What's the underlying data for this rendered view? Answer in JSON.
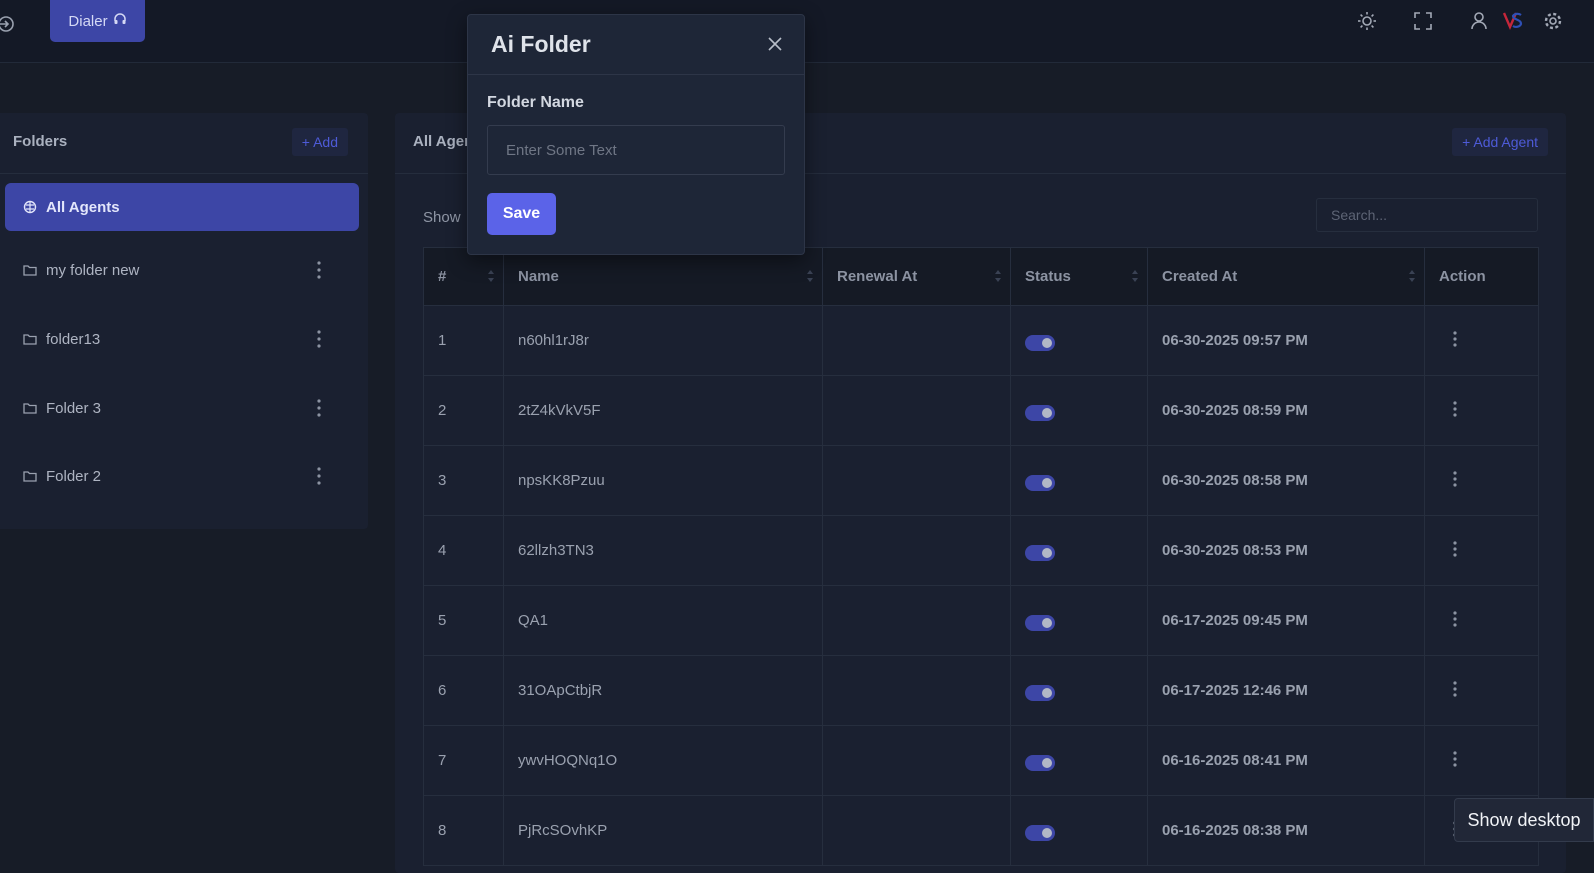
{
  "topbar": {
    "dialer_label": "Dialer"
  },
  "sidebar": {
    "title": "Folders",
    "add_label": "+ Add",
    "items": [
      {
        "label": "All Agents"
      },
      {
        "label": "my folder new"
      },
      {
        "label": "folder13"
      },
      {
        "label": "Folder 3"
      },
      {
        "label": "Folder 2"
      }
    ]
  },
  "main": {
    "title": "All Agents",
    "add_agent_label": "+ Add Agent",
    "show_label": "Show",
    "search_placeholder": "Search...",
    "columns": [
      "#",
      "Name",
      "Renewal At",
      "Status",
      "Created At",
      "Action"
    ],
    "rows": [
      {
        "num": "1",
        "name": "n60hl1rJ8r",
        "renewal": "",
        "status": true,
        "created": "06-30-2025 09:57 PM"
      },
      {
        "num": "2",
        "name": "2tZ4kVkV5F",
        "renewal": "",
        "status": true,
        "created": "06-30-2025 08:59 PM"
      },
      {
        "num": "3",
        "name": "npsKK8Pzuu",
        "renewal": "",
        "status": true,
        "created": "06-30-2025 08:58 PM"
      },
      {
        "num": "4",
        "name": "62llzh3TN3",
        "renewal": "",
        "status": true,
        "created": "06-30-2025 08:53 PM"
      },
      {
        "num": "5",
        "name": "QA1",
        "renewal": "",
        "status": true,
        "created": "06-17-2025 09:45 PM"
      },
      {
        "num": "6",
        "name": "31OApCtbjR",
        "renewal": "",
        "status": true,
        "created": "06-17-2025 12:46 PM"
      },
      {
        "num": "7",
        "name": "ywvHOQNq1O",
        "renewal": "",
        "status": true,
        "created": "06-16-2025 08:41 PM"
      },
      {
        "num": "8",
        "name": "PjRcSOvhKP",
        "renewal": "",
        "status": true,
        "created": "06-16-2025 08:38 PM"
      }
    ]
  },
  "modal": {
    "title": "Ai Folder",
    "field_label": "Folder Name",
    "input_placeholder": "Enter Some Text",
    "input_value": "",
    "save_label": "Save"
  },
  "tooltip": {
    "text": "Show desktop"
  },
  "colors": {
    "accent": "#3d46a6",
    "primary_button": "#5b63e8",
    "background": "#171c27",
    "panel": "#1a2030"
  }
}
